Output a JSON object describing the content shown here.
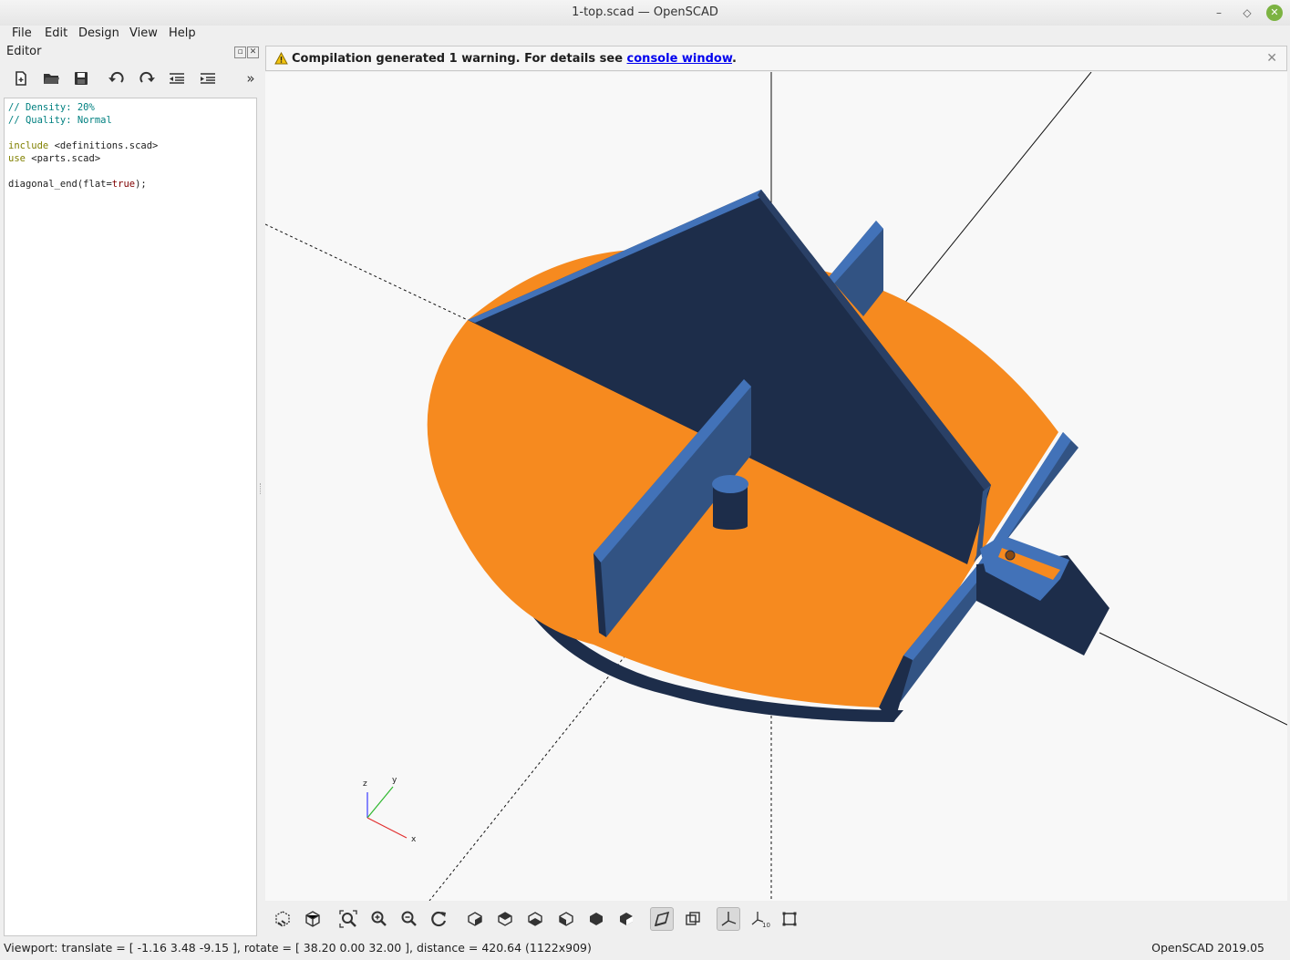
{
  "window": {
    "title": "1-top.scad — OpenSCAD",
    "minimize": "–",
    "maximize": "◇",
    "close": "✕"
  },
  "menu": [
    "File",
    "Edit",
    "Design",
    "View",
    "Help"
  ],
  "editor": {
    "title": "Editor",
    "float_btn": "▫",
    "close_btn": "✕",
    "toolbar": [
      "new-file",
      "open-file",
      "save-file",
      "undo",
      "redo",
      "unindent",
      "indent",
      "more"
    ],
    "more_label": "»",
    "code": {
      "line1": "// Density: 20%",
      "line2": "// Quality: Normal",
      "include_kw": "include",
      "include_arg": " <definitions.scad>",
      "use_kw": "use",
      "use_arg": " <parts.scad>",
      "call_name": "diagonal_end(flat=",
      "call_value": "true",
      "call_end": ");"
    }
  },
  "warning": {
    "text": "Compilation generated 1 warning. For details see ",
    "link": "console window",
    "tail": ".",
    "close": "✕"
  },
  "axes_gizmo": {
    "z": "z",
    "y": "y",
    "x": "x"
  },
  "colors": {
    "orange": "#f68a1f",
    "dark_blue": "#1d2d4a",
    "mid_blue": "#325383",
    "light_blue": "#4272b8",
    "background": "#f8f8f8"
  },
  "view_toolbar": [
    "preview",
    "render",
    "view-all",
    "zoom-in",
    "zoom-out",
    "reset-view",
    "view-right",
    "view-top",
    "view-bottom",
    "view-left",
    "view-front",
    "view-back",
    "perspective",
    "orthogonal",
    "show-axes",
    "show-scale-markers",
    "show-edges"
  ],
  "status": {
    "viewport": "Viewport: translate = [ -1.16 3.48 -9.15 ], rotate = [ 38.20 0.00 32.00 ], distance = 420.64 (1122x909)",
    "version": "OpenSCAD 2019.05"
  }
}
